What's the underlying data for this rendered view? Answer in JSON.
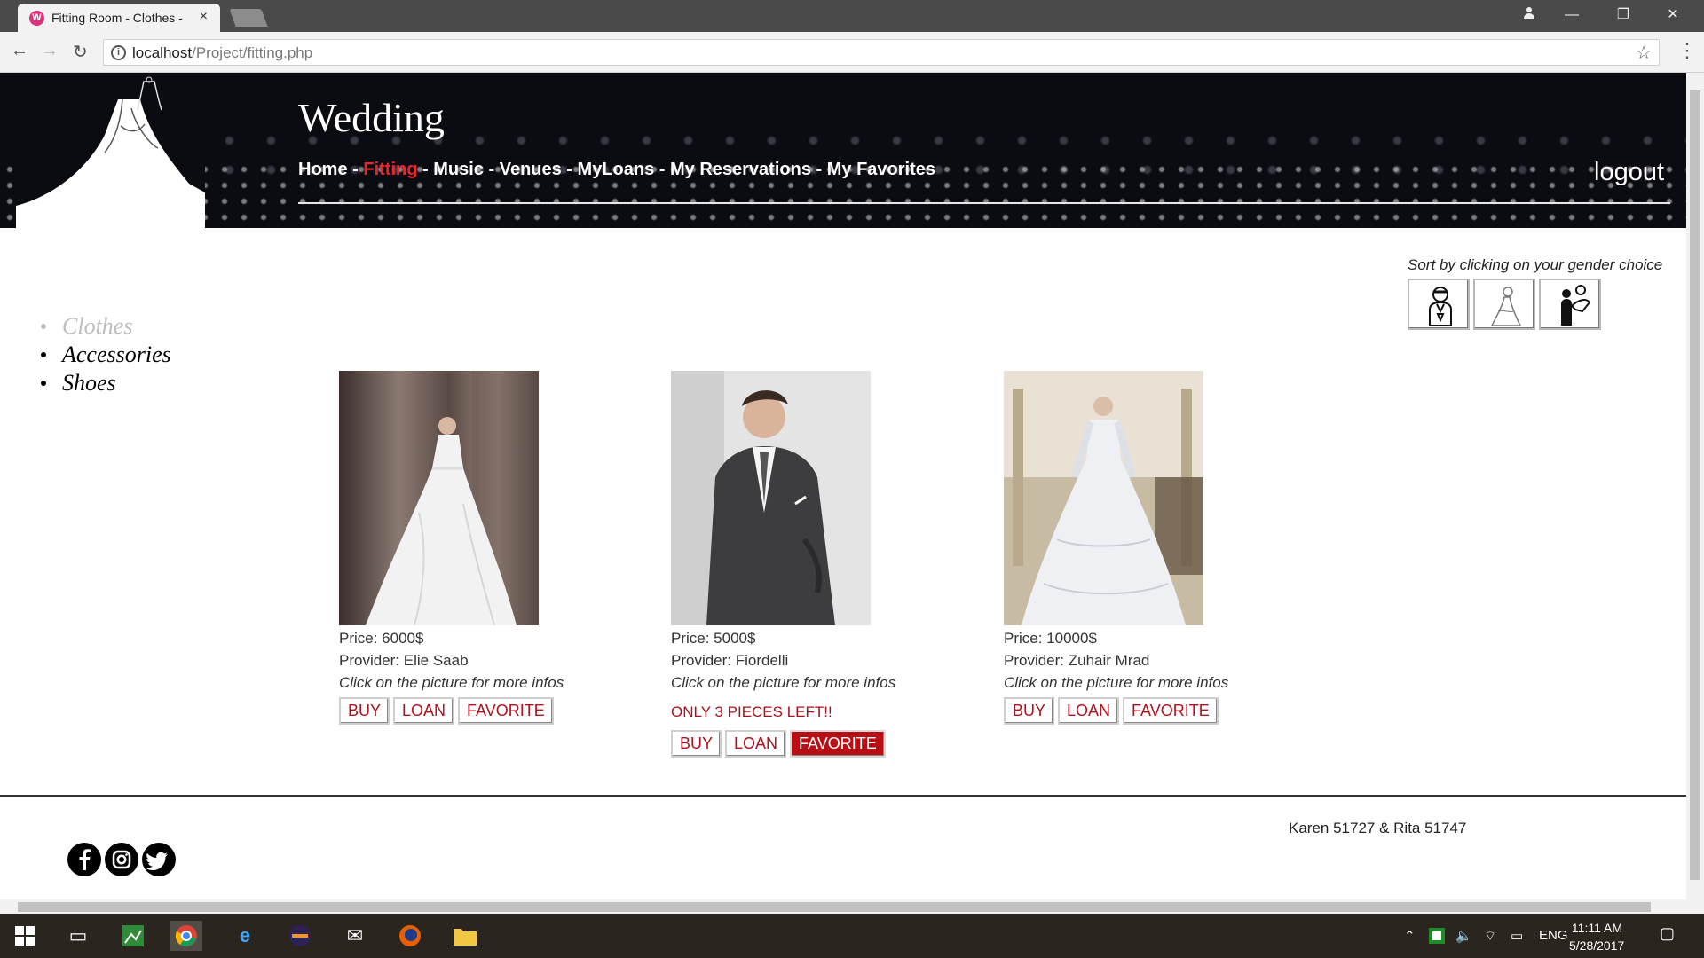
{
  "browser": {
    "tab_title": "Fitting Room - Clothes -",
    "tab_close": "×",
    "url_host": "localhost",
    "url_path": "/Project/fitting.php",
    "info_icon": "i",
    "win_minimize": "—",
    "win_restore": "❐",
    "win_close": "✕"
  },
  "header": {
    "title": "Wedding",
    "nav": [
      {
        "label": "Home"
      },
      {
        "label": "Fitting",
        "active": true
      },
      {
        "label": "Music"
      },
      {
        "label": "Venues"
      },
      {
        "label": "MyLoans"
      },
      {
        "label": "My Reservations"
      },
      {
        "label": "My Favorites"
      }
    ],
    "separator": " - ",
    "logout": "logout"
  },
  "sort": {
    "label": "Sort by clicking on your gender choice",
    "options": [
      "groom-icon",
      "bride-icon",
      "couple-icon"
    ]
  },
  "sidebar": {
    "items": [
      {
        "label": "Clothes",
        "active": true
      },
      {
        "label": "Accessories"
      },
      {
        "label": "Shoes"
      }
    ]
  },
  "products": [
    {
      "price": "Price: 6000$",
      "provider": "Provider: Elie Saab",
      "hint": "Click on the picture for more infos",
      "stock": "",
      "buy": "BUY",
      "loan": "LOAN",
      "favorite": "FAVORITE",
      "favorited": false,
      "image": "wedding-dress-photo"
    },
    {
      "price": "Price: 5000$",
      "provider": "Provider: Fiordelli",
      "hint": "Click on the picture for more infos",
      "stock": "ONLY 3 PIECES LEFT!!",
      "buy": "BUY",
      "loan": "LOAN",
      "favorite": "FAVORITE",
      "favorited": true,
      "image": "groom-suit-photo"
    },
    {
      "price": "Price: 10000$",
      "provider": "Provider: Zuhair Mrad",
      "hint": "Click on the picture for more infos",
      "stock": "",
      "buy": "BUY",
      "loan": "LOAN",
      "favorite": "FAVORITE",
      "favorited": false,
      "image": "lace-dress-photo"
    }
  ],
  "footer": {
    "credits": "Karen 51727 & Rita 51747",
    "social": [
      "facebook-icon",
      "instagram-icon",
      "twitter-icon"
    ]
  },
  "taskbar": {
    "language": "ENG",
    "time": "11:11 AM",
    "date": "5/28/2017"
  },
  "colors": {
    "accent_red": "#b0121d",
    "nav_active": "#e8262a",
    "banner_bg": "#0b0b12"
  }
}
